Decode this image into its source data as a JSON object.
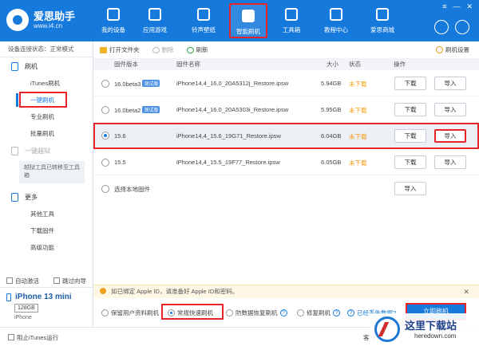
{
  "app": {
    "name": "爱思助手",
    "url": "www.i4.cn",
    "window_buttons": [
      "≡",
      "—",
      "✕"
    ]
  },
  "nav": [
    {
      "label": "我的设备",
      "icon": "phone-icon"
    },
    {
      "label": "应用游戏",
      "icon": "apps-icon"
    },
    {
      "label": "铃声壁纸",
      "icon": "wallpaper-icon"
    },
    {
      "label": "智能刷机",
      "icon": "flash-icon",
      "active": true
    },
    {
      "label": "工具箱",
      "icon": "toolbox-icon"
    },
    {
      "label": "教程中心",
      "icon": "tutorial-icon"
    },
    {
      "label": "爱思商城",
      "icon": "store-icon"
    }
  ],
  "sidebar": {
    "connection_status": "设备连接状态：正常模式",
    "flash_header": "刷机",
    "flash_items": [
      "iTunes刷机",
      "一键刷机",
      "专业刷机",
      "批量刷机"
    ],
    "jailbreak_header": "一键越狱",
    "jailbreak_note": "越狱工具已转移至工具箱",
    "more_header": "更多",
    "more_items": [
      "其他工具",
      "下载固件",
      "高级功能"
    ],
    "auto_activate": "自动激活",
    "skip_guide": "跳过向导",
    "device_name": "iPhone 13 mini",
    "device_capacity": "128GB",
    "device_type": "iPhone"
  },
  "toolbar": {
    "open_folder": "打开文件夹",
    "delete": "删除",
    "refresh": "刷新",
    "settings": "刷机设置"
  },
  "table": {
    "headers": [
      "固件版本",
      "固件名称",
      "大小",
      "状态",
      "操作"
    ],
    "rows": [
      {
        "version": "16.0beta3",
        "beta": "测试版",
        "name": "iPhone14,4_16.0_20A5312j_Restore.ipsw",
        "size": "5.94GB",
        "status": "未下载",
        "download": "下载",
        "import": "导入"
      },
      {
        "version": "16.0beta2",
        "beta": "测试版",
        "name": "iPhone14,4_16.0_20A5303i_Restore.ipsw",
        "size": "5.95GB",
        "status": "未下载",
        "download": "下载",
        "import": "导入"
      },
      {
        "version": "15.6",
        "beta": "",
        "name": "iPhone14,4_15.6_19G71_Restore.ipsw",
        "size": "6.04GB",
        "status": "未下载",
        "download": "下载",
        "import": "导入"
      },
      {
        "version": "15.5",
        "beta": "",
        "name": "iPhone14,4_15.5_19F77_Restore.ipsw",
        "size": "6.05GB",
        "status": "未下载",
        "download": "下载",
        "import": "导入"
      }
    ],
    "local_firmware": "选择本地固件",
    "local_import": "导入"
  },
  "banner": {
    "text": "如已绑定 Apple ID，请准备好 Apple ID和密码。",
    "close": "✕"
  },
  "modes": {
    "keep_data": "保留用户资料刷机",
    "quick": "常规快速刷机",
    "anti_recovery": "防数据恢复刷机",
    "repair": "修复刷机",
    "data_loss_link": "已经丢失数据?",
    "flash_button": "立即刷机"
  },
  "statusbar": {
    "block_itunes": "阻止iTunes运行",
    "right_text": "客服"
  },
  "watermark": {
    "cn": "这里下载站",
    "en": "heredown.com"
  },
  "colors": {
    "brand_blue": "#1679dc",
    "highlight_red": "#e8242a",
    "status_orange": "#f39c12"
  }
}
